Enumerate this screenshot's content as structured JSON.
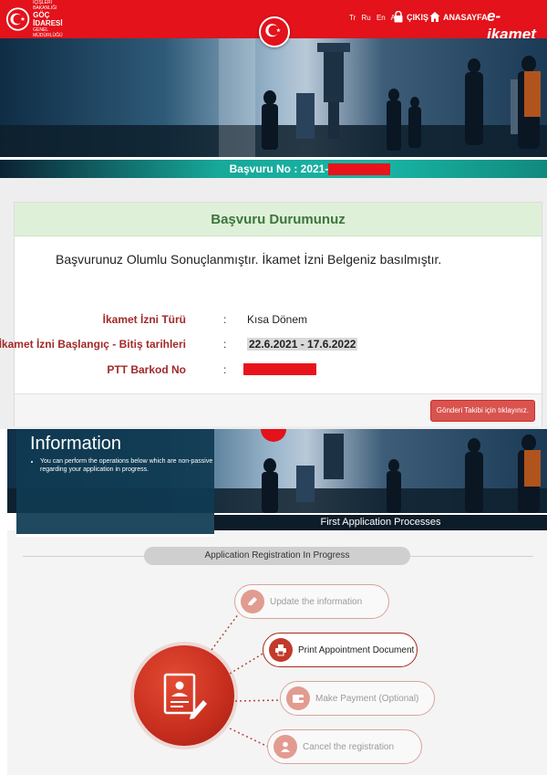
{
  "header": {
    "logo_lines": [
      "İÇİŞLERİ BAKANLIĞI",
      "GÖÇ İDARESİ",
      "GENEL MÜDÜRLÜĞÜ"
    ],
    "languages": [
      "Tr",
      "Ru",
      "En",
      "Ar"
    ],
    "logout_label": "ÇIKIŞ",
    "home_label": "ANASAYFA",
    "brand": "e-ikamet"
  },
  "application_number": {
    "label": "Başvuru No : 2021-"
  },
  "status_panel": {
    "title": "Başvuru Durumunuz",
    "message": "Başvurunuz Olumlu Sonuçlanmıştır. İkamet İzni Belgeniz basılmıştır.",
    "rows": [
      {
        "label": "İkamet İzni Türü",
        "separator": ":",
        "value": "Kısa Dönem"
      },
      {
        "label": "İkamet İzni Başlangıç - Bitiş tarihleri",
        "separator": ":",
        "value": "22.6.2021 - 17.6.2022"
      },
      {
        "label": "PTT Barkod No",
        "separator": ":",
        "value": ""
      }
    ],
    "tracking_button": "Gönderi Takibi için tıklayınız."
  },
  "info_box": {
    "title": "Information",
    "bullet": "You can perform the operations below which are non-passive regarding your application in progress."
  },
  "section_bar": "First Application Processes",
  "registration_status": "Application Registration In Progress",
  "steps": [
    {
      "label": "Update the information",
      "icon": "edit-icon",
      "active": false
    },
    {
      "label": "Print Appointment Document",
      "icon": "printer-icon",
      "active": true
    },
    {
      "label": "Make Payment (Optional)",
      "icon": "wallet-icon",
      "active": false
    },
    {
      "label": "Cancel the registration",
      "icon": "person-cancel-icon",
      "active": false
    }
  ],
  "colors": {
    "brand_red": "#e3121b",
    "teal_strip": "#19b4a4",
    "panel_header_bg": "#dff0d8",
    "panel_header_text": "#3c763d",
    "label_red": "#a12a2a",
    "button_red": "#d9534f",
    "info_bg": "#0f3a52",
    "hub_red": "#c62d1d"
  }
}
